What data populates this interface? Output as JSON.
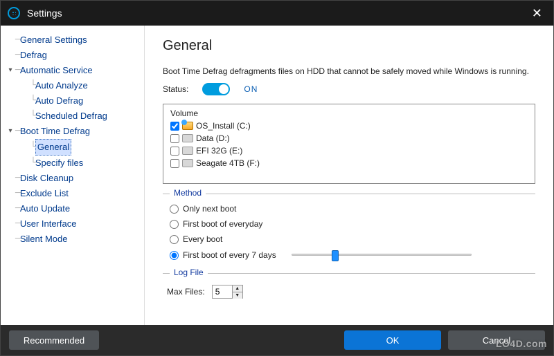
{
  "titlebar": {
    "title": "Settings"
  },
  "sidebar": {
    "items": [
      {
        "label": "General Settings",
        "depth": 0
      },
      {
        "label": "Defrag",
        "depth": 0
      },
      {
        "label": "Automatic Service",
        "depth": 0,
        "expandable": true,
        "expanded": true
      },
      {
        "label": "Auto Analyze",
        "depth": 1
      },
      {
        "label": "Auto Defrag",
        "depth": 1
      },
      {
        "label": "Scheduled Defrag",
        "depth": 1
      },
      {
        "label": "Boot Time Defrag",
        "depth": 0,
        "expandable": true,
        "expanded": true
      },
      {
        "label": "General",
        "depth": 1,
        "selected": true
      },
      {
        "label": "Specify files",
        "depth": 1
      },
      {
        "label": "Disk Cleanup",
        "depth": 0
      },
      {
        "label": "Exclude List",
        "depth": 0
      },
      {
        "label": "Auto Update",
        "depth": 0
      },
      {
        "label": "User Interface",
        "depth": 0
      },
      {
        "label": "Silent Mode",
        "depth": 0
      }
    ]
  },
  "main": {
    "heading": "General",
    "description": "Boot Time Defrag defragments files on HDD that cannot be safely moved while Windows is running.",
    "status_label": "Status:",
    "status_on": true,
    "status_text": "ON",
    "volume_header": "Volume",
    "volumes": [
      {
        "label": "OS_Install (C:)",
        "checked": true,
        "system": true
      },
      {
        "label": "Data (D:)",
        "checked": false,
        "system": false
      },
      {
        "label": "EFI 32G (E:)",
        "checked": false,
        "system": false
      },
      {
        "label": "Seagate 4TB (F:)",
        "checked": false,
        "system": false
      }
    ],
    "method_legend": "Method",
    "method_options": [
      {
        "label": "Only next boot",
        "value": "next"
      },
      {
        "label": "First boot of everyday",
        "value": "daily"
      },
      {
        "label": "Every boot",
        "value": "every"
      },
      {
        "label": "First boot of every 7 days",
        "value": "weekly"
      }
    ],
    "method_selected": "weekly",
    "slider_days": 7,
    "log_legend": "Log File",
    "maxfiles_label": "Max Files:",
    "maxfiles_value": "5"
  },
  "footer": {
    "recommended": "Recommended",
    "ok": "OK",
    "cancel": "Cancel"
  },
  "watermark": "LO4D.com"
}
